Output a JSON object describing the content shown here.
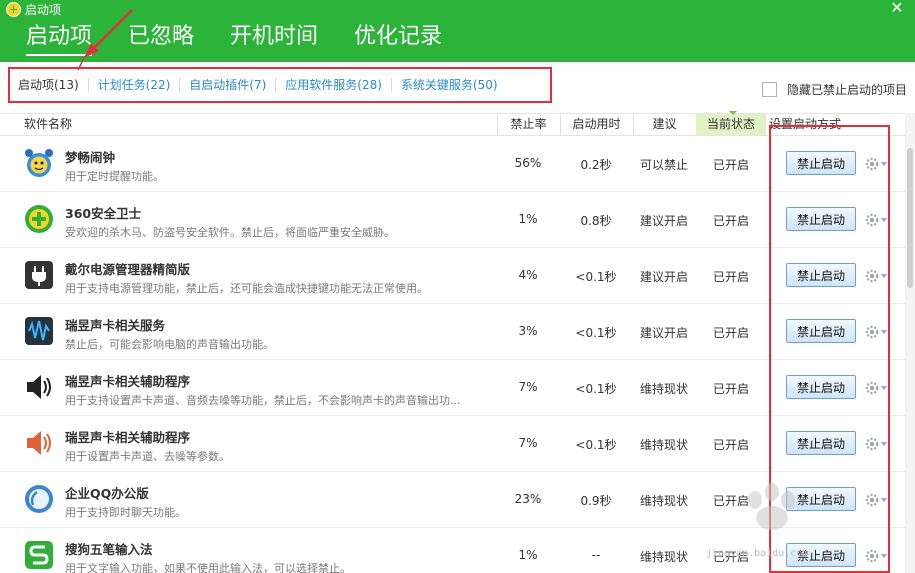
{
  "window": {
    "title": "启动项",
    "close_glyph": "✕"
  },
  "main_tabs": [
    {
      "label": "启动项",
      "active": true
    },
    {
      "label": "已忽略",
      "active": false
    },
    {
      "label": "开机时间",
      "active": false
    },
    {
      "label": "优化记录",
      "active": false
    }
  ],
  "sub_tabs": [
    {
      "label": "启动项(13)",
      "active": true
    },
    {
      "label": "计划任务(22)",
      "active": false
    },
    {
      "label": "自启动插件(7)",
      "active": false
    },
    {
      "label": "应用软件服务(28)",
      "active": false
    },
    {
      "label": "系统关键服务(50)",
      "active": false
    }
  ],
  "hide_disabled": {
    "label": "隐藏已禁止启动的项目",
    "checked": false
  },
  "columns": {
    "name": "软件名称",
    "rate": "禁止率",
    "time": "启动用时",
    "advice": "建议",
    "state": "当前状态",
    "setting": "设置启动方式"
  },
  "rows": [
    {
      "name": "梦畅闹钟",
      "desc": "用于定时提醒功能。",
      "rate": "56%",
      "time": "0.2秒",
      "advice": "可以禁止",
      "state": "已开启",
      "action": "禁止启动",
      "icon": "alarm-clock-icon"
    },
    {
      "name": "360安全卫士",
      "desc": "受欢迎的杀木马、防盗号安全软件。禁止后，将面临严重安全威胁。",
      "rate": "1%",
      "time": "0.8秒",
      "advice": "建议开启",
      "state": "已开启",
      "action": "禁止启动",
      "icon": "360-shield-icon"
    },
    {
      "name": "戴尔电源管理器精简版",
      "desc": "用于支持电源管理功能，禁止后，还可能会造成快捷键功能无法正常使用。",
      "rate": "4%",
      "time": "<0.1秒",
      "advice": "建议开启",
      "state": "已开启",
      "action": "禁止启动",
      "icon": "power-plug-icon"
    },
    {
      "name": "瑞昱声卡相关服务",
      "desc": "禁止后，可能会影响电脑的声音输出功能。",
      "rate": "3%",
      "time": "<0.1秒",
      "advice": "建议开启",
      "state": "已开启",
      "action": "禁止启动",
      "icon": "audio-wave-icon"
    },
    {
      "name": "瑞昱声卡相关辅助程序",
      "desc": "用于支持设置声卡声道、音频去噪等功能，禁止后，不会影响声卡的声音输出功...",
      "rate": "7%",
      "time": "<0.1秒",
      "advice": "维持现状",
      "state": "已开启",
      "action": "禁止启动",
      "icon": "speaker-icon"
    },
    {
      "name": "瑞昱声卡相关辅助程序",
      "desc": "用于设置声卡声道、去噪等参数。",
      "rate": "7%",
      "time": "<0.1秒",
      "advice": "维持现状",
      "state": "已开启",
      "action": "禁止启动",
      "icon": "volume-icon"
    },
    {
      "name": "企业QQ办公版",
      "desc": "用于支持即时聊天功能。",
      "rate": "23%",
      "time": "0.9秒",
      "advice": "维持现状",
      "state": "已开启",
      "action": "禁止启动",
      "icon": "qq-icon"
    },
    {
      "name": "搜狗五笔输入法",
      "desc": "用于文字输入功能，如果不使用此输入法，可以选择禁止。",
      "rate": "1%",
      "time": "--",
      "advice": "维持现状",
      "state": "已开启",
      "action": "禁止启动",
      "icon": "sogou-icon"
    }
  ],
  "watermark": {
    "text": "Baidu 经验",
    "url_text": "jingyan.baidu.com"
  },
  "colors": {
    "header_green": "#2cb43a",
    "link_blue": "#2a8ad0",
    "highlight_red": "#e0313a",
    "state_header_bg": "#e1f2c6"
  }
}
